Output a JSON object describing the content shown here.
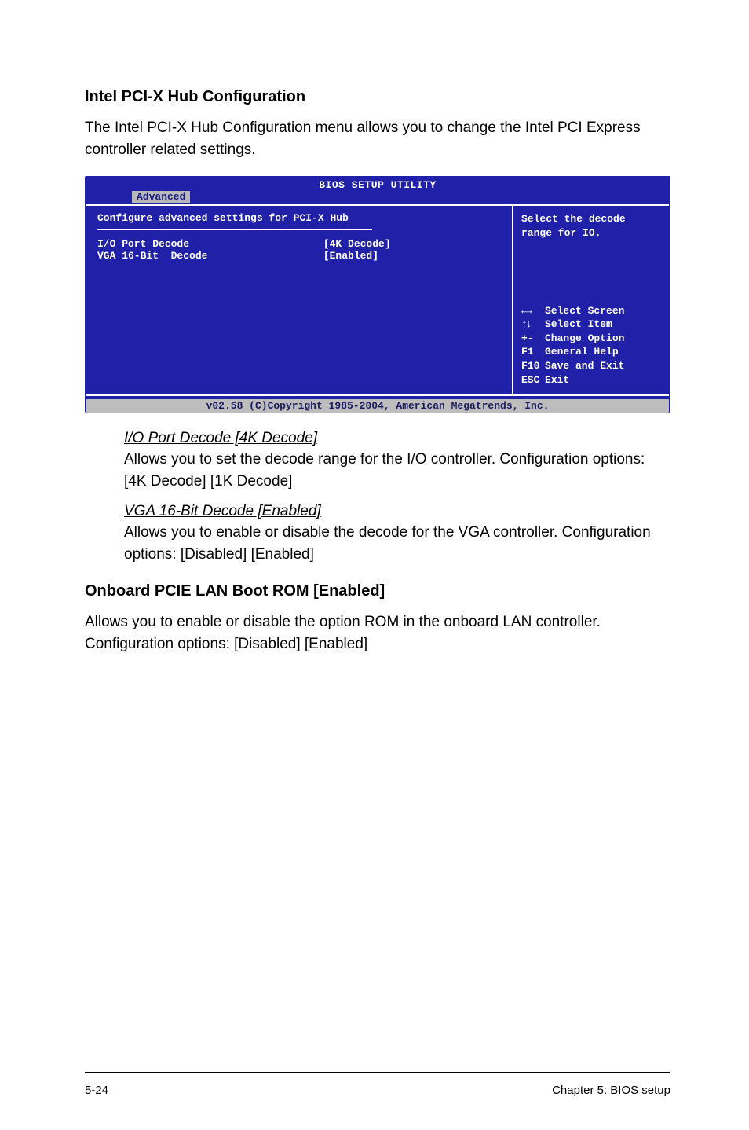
{
  "section1": {
    "heading": "Intel PCI-X Hub Configuration",
    "description": "The Intel PCI-X Hub Configuration menu allows you to change the Intel PCI Express controller related settings."
  },
  "bios": {
    "title": "BIOS SETUP UTILITY",
    "tab": "Advanced",
    "config_heading": "Configure advanced settings for PCI-X Hub",
    "rows": [
      {
        "label": "I/O Port Decode",
        "value": "[4K Decode]"
      },
      {
        "label": "VGA 16-Bit  Decode",
        "value": "[Enabled]"
      }
    ],
    "help": "Select the decode range for IO.",
    "keys": [
      {
        "icon": "arrow-lr",
        "text": "Select Screen"
      },
      {
        "icon": "arrow-ud",
        "text": "Select Item"
      },
      {
        "icon": "+-",
        "text": "Change Option"
      },
      {
        "icon": "F1",
        "text": "General Help"
      },
      {
        "icon": "F10",
        "text": "Save and Exit"
      },
      {
        "icon": "ESC",
        "text": "Exit"
      }
    ],
    "footer": "v02.58 (C)Copyright 1985-2004, American Megatrends, Inc."
  },
  "subitems": [
    {
      "title": "I/O Port Decode [4K Decode]",
      "text": "Allows you to set the decode range for the I/O controller. Configuration options: [4K Decode] [1K Decode]"
    },
    {
      "title": "VGA 16-Bit Decode [Enabled]",
      "text": "Allows you to enable or disable the decode for the VGA controller. Configuration options: [Disabled] [Enabled]"
    }
  ],
  "section2": {
    "heading": "Onboard PCIE LAN Boot ROM [Enabled]",
    "description": "Allows you to enable or disable the option ROM in the onboard LAN controller. Configuration options: [Disabled] [Enabled]"
  },
  "pageFooter": {
    "left": "5-24",
    "right": "Chapter 5: BIOS setup"
  }
}
